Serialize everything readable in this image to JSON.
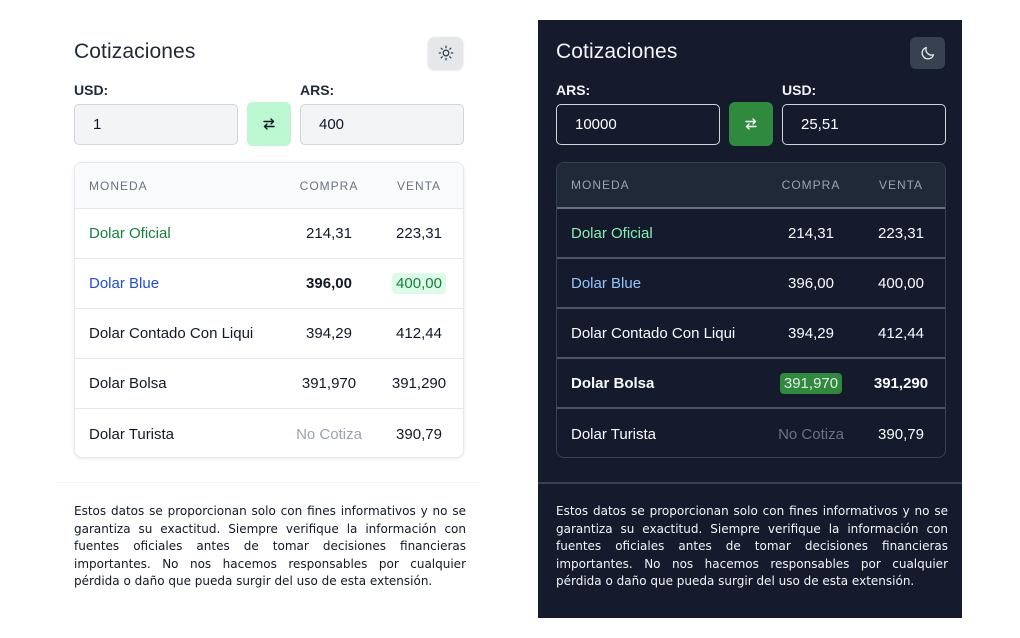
{
  "light": {
    "title": "Cotizaciones",
    "theme_icon": "sun-icon",
    "from_label": "USD:",
    "from_value": "1",
    "to_label": "ARS:",
    "to_value": "400",
    "headers": {
      "currency": "MONEDA",
      "buy": "COMPRA",
      "sell": "VENTA"
    },
    "rows": [
      {
        "name": "Dolar Oficial",
        "buy": "214,31",
        "sell": "223,31"
      },
      {
        "name": "Dolar Blue",
        "buy": "396,00",
        "sell": "400,00"
      },
      {
        "name": "Dolar Contado Con Liqui",
        "buy": "394,29",
        "sell": "412,44"
      },
      {
        "name": "Dolar Bolsa",
        "buy": "391,970",
        "sell": "391,290"
      },
      {
        "name": "Dolar Turista",
        "buy": "No Cotiza",
        "sell": "390,79"
      }
    ],
    "disclaimer": "Estos datos se proporcionan solo con fines informativos y no se garantiza su exactitud. Siempre verifique la información con fuentes oficiales antes de tomar decisiones financieras importantes. No nos hacemos responsables por cualquier pérdida o daño que pueda surgir del uso de esta extensión."
  },
  "dark": {
    "title": "Cotizaciones",
    "theme_icon": "moon-icon",
    "from_label": "ARS:",
    "from_value": "10000",
    "to_label": "USD:",
    "to_value": "25,51",
    "headers": {
      "currency": "MONEDA",
      "buy": "COMPRA",
      "sell": "VENTA"
    },
    "rows": [
      {
        "name": "Dolar Oficial",
        "buy": "214,31",
        "sell": "223,31"
      },
      {
        "name": "Dolar Blue",
        "buy": "396,00",
        "sell": "400,00"
      },
      {
        "name": "Dolar Contado Con Liqui",
        "buy": "394,29",
        "sell": "412,44"
      },
      {
        "name": "Dolar Bolsa",
        "buy": "391,970",
        "sell": "391,290"
      },
      {
        "name": "Dolar Turista",
        "buy": "No Cotiza",
        "sell": "390,79"
      }
    ],
    "disclaimer": "Estos datos se proporcionan solo con fines informativos y no se garantiza su exactitud. Siempre verifique la información con fuentes oficiales antes de tomar decisiones financieras importantes. No nos hacemos responsables por cualquier pérdida o daño que pueda surgir del uso de esta extensión."
  },
  "colors": {
    "accent_green": "#2f8a3e",
    "light_green": "#bbf7d0",
    "dark_bg": "#151b2c",
    "blue_link": "#1d4ed8"
  }
}
